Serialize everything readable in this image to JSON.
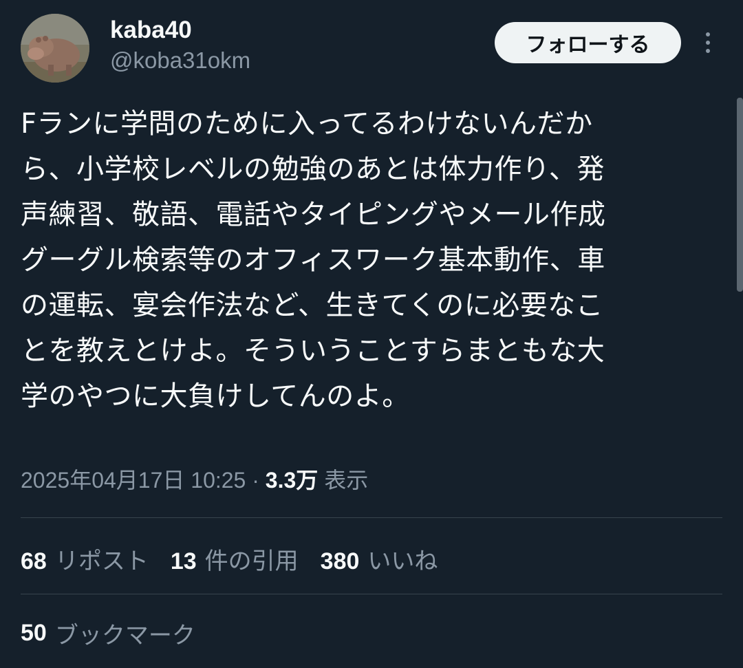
{
  "author": {
    "display_name": "kaba40",
    "handle": "@koba31okm"
  },
  "actions": {
    "follow_label": "フォローする"
  },
  "tweet": {
    "text": "Fランに学問のために入ってるわけないんだか\nら、小学校レベルの勉強のあとは体力作り、発\n声練習、敬語、電話やタイピングやメール作成\nグーグル検索等のオフィスワーク基本動作、車\nの運転、宴会作法など、生きてくのに必要なこ\nとを教えとけよ。そういうことすらまともな大\n学のやつに大負けしてんのよ。",
    "datetime": "2025年04月17日 10:25",
    "separator": "·",
    "views_count": "3.3万",
    "views_label": "表示"
  },
  "stats": {
    "reposts_count": "68",
    "reposts_label": "リポスト",
    "quotes_count": "13",
    "quotes_label": "件の引用",
    "likes_count": "380",
    "likes_label": "いいね",
    "bookmarks_count": "50",
    "bookmarks_label": "ブックマーク"
  },
  "icons": {
    "more": "more-vertical-icon",
    "avatar": "hippo-avatar"
  },
  "colors": {
    "background": "#15202b",
    "primary_text": "#f7f9f9",
    "secondary_text": "#8b98a5",
    "divider": "#38444d",
    "follow_button_bg": "#eff3f4",
    "follow_button_text": "#0f1419"
  }
}
